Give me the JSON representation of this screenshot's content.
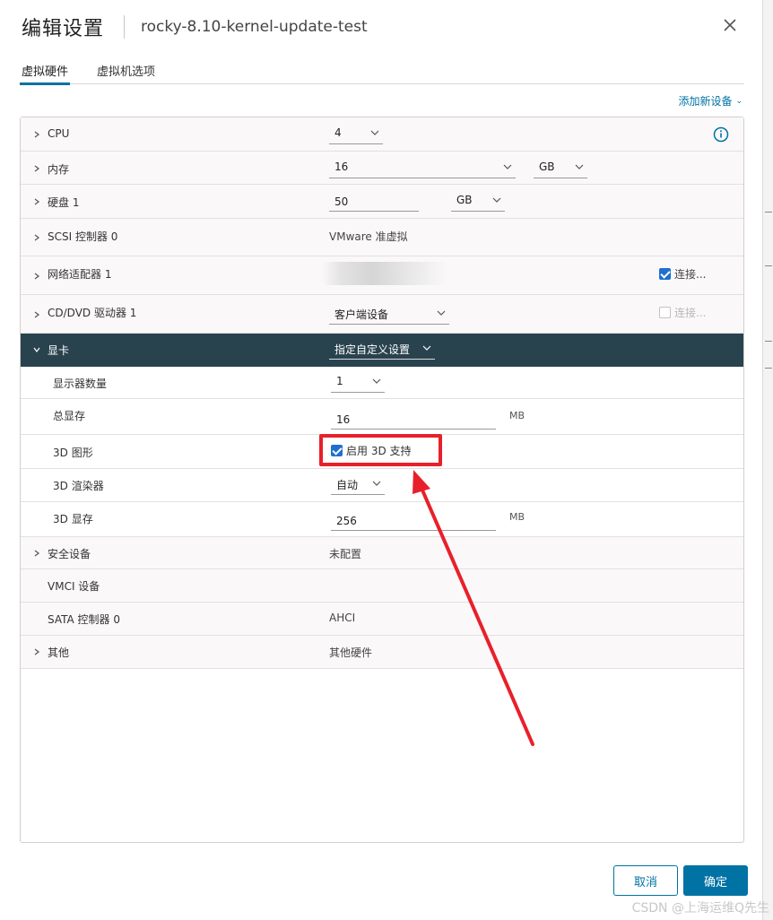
{
  "header": {
    "title": "编辑设置",
    "subtitle": "rocky-8.10-kernel-update-test"
  },
  "tabs": [
    {
      "label": "虚拟硬件"
    },
    {
      "label": "虚拟机选项"
    }
  ],
  "add_device": {
    "label": "添加新设备"
  },
  "rows": {
    "cpu": {
      "label": "CPU",
      "value": "4"
    },
    "memory": {
      "label": "内存",
      "value": "16",
      "unit": "GB"
    },
    "disk": {
      "label": "硬盘 1",
      "value": "50",
      "unit": "GB"
    },
    "scsi": {
      "label": "SCSI 控制器 0",
      "value": "VMware 准虚拟"
    },
    "network": {
      "label": "网络适配器 1",
      "connect_label": "连接..."
    },
    "cddvd": {
      "label": "CD/DVD 驱动器 1",
      "value": "客户端设备",
      "connect_label": "连接..."
    },
    "video": {
      "label": "显卡",
      "value": "指定自定义设置"
    },
    "displays": {
      "label": "显示器数量",
      "value": "1"
    },
    "total_vram": {
      "label": "总显存",
      "value": "16",
      "unit": "MB"
    },
    "graphics3d": {
      "label": "3D 图形",
      "checkbox_label": "启用 3D 支持"
    },
    "renderer3d": {
      "label": "3D 渲染器",
      "value": "自动"
    },
    "memory3d": {
      "label": "3D 显存",
      "value": "256",
      "unit": "MB"
    },
    "security": {
      "label": "安全设备",
      "value": "未配置"
    },
    "vmci": {
      "label": "VMCI 设备"
    },
    "sata": {
      "label": "SATA 控制器 0",
      "value": "AHCI"
    },
    "other": {
      "label": "其他",
      "value": "其他硬件"
    }
  },
  "footer": {
    "cancel": "取消",
    "ok": "确定"
  },
  "watermark": "CSDN @上海运维Q先生",
  "colors": {
    "accent": "#0072a3",
    "selected_row": "#29434e",
    "highlight": "#e8202a",
    "checkbox": "#1e6fd0"
  }
}
